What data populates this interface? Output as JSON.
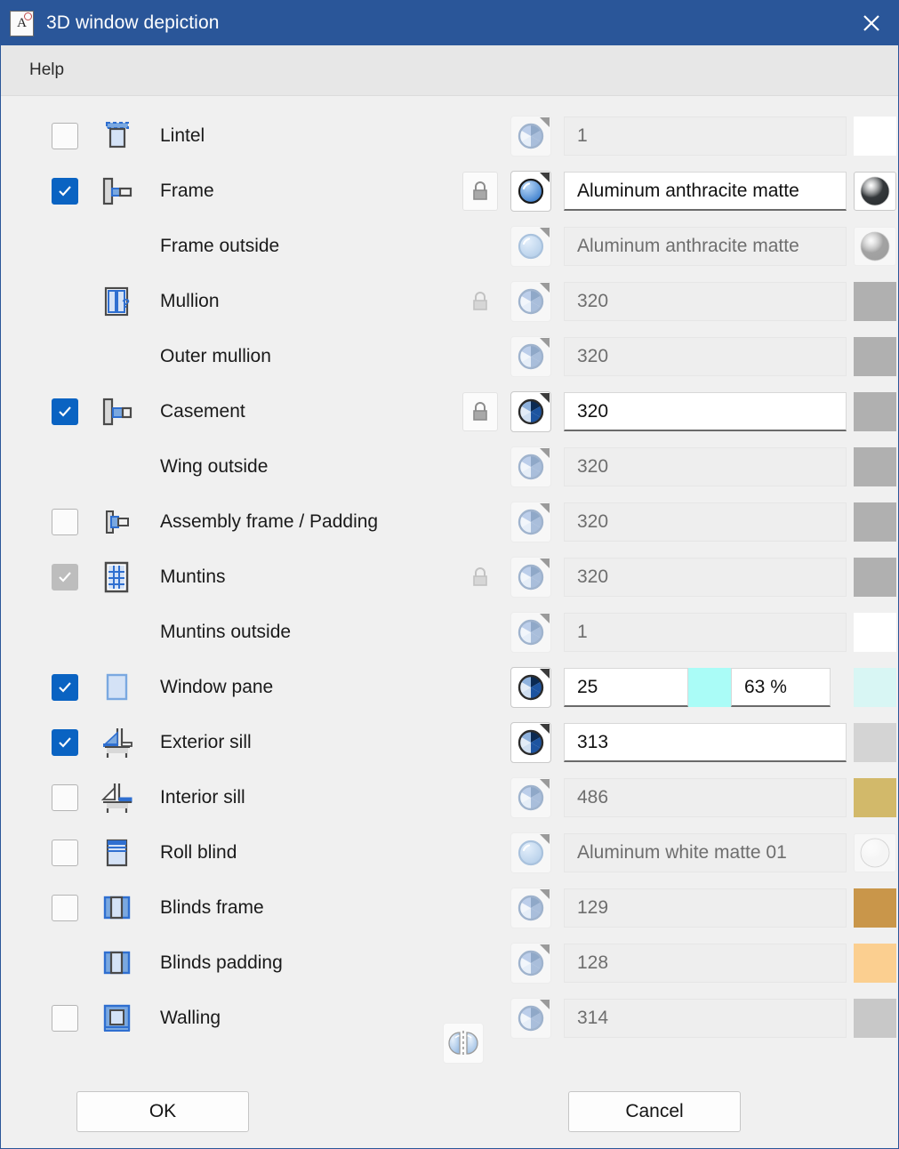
{
  "window": {
    "title": "3D window depiction",
    "app_icon": "A",
    "close_icon": "close-icon"
  },
  "menu": {
    "items": [
      {
        "label": "Help"
      }
    ]
  },
  "colors": {
    "titlebar": "#2a5699",
    "accent_checkbox": "#0a63c2",
    "disabled_checkbox": "#bdbdbd",
    "dialog_background": "#f0f0f0",
    "menubar": "#e7e7e7"
  },
  "rows": [
    {
      "label": "Lintel",
      "checkbox": "unchecked",
      "icon": "lintel-icon",
      "lock": "none",
      "picker": "color",
      "picker_active": false,
      "value": "1",
      "field_active": false,
      "swatch_type": "flat",
      "swatch_color": "#ffffff"
    },
    {
      "label": "Frame",
      "checkbox": "checked",
      "icon": "frame-icon",
      "lock": "locked",
      "picker": "material",
      "picker_active": true,
      "value": "Aluminum anthracite matte",
      "field_active": true,
      "swatch_type": "material",
      "swatch_color": "#2a2e31"
    },
    {
      "label": "Frame outside",
      "checkbox": "none",
      "icon": "none",
      "lock": "none",
      "picker": "material",
      "picker_active": false,
      "value": "Aluminum anthracite matte",
      "field_active": false,
      "swatch_type": "material",
      "swatch_color": "#9e9e9e"
    },
    {
      "label": "Mullion",
      "checkbox": "none",
      "icon": "mullion-icon",
      "lock": "locked-disabled",
      "picker": "color",
      "picker_active": false,
      "value": "320",
      "field_active": false,
      "swatch_type": "flat",
      "swatch_color": "#b0b0b0"
    },
    {
      "label": "Outer mullion",
      "checkbox": "none",
      "icon": "none",
      "lock": "none",
      "picker": "color",
      "picker_active": false,
      "value": "320",
      "field_active": false,
      "swatch_type": "flat",
      "swatch_color": "#b0b0b0"
    },
    {
      "label": "Casement",
      "checkbox": "checked",
      "icon": "casement-icon",
      "lock": "locked",
      "picker": "color",
      "picker_active": true,
      "value": "320",
      "field_active": true,
      "swatch_type": "flat",
      "swatch_color": "#b0b0b0"
    },
    {
      "label": "Wing outside",
      "checkbox": "none",
      "icon": "none",
      "lock": "none",
      "picker": "color",
      "picker_active": false,
      "value": "320",
      "field_active": false,
      "swatch_type": "flat",
      "swatch_color": "#b0b0b0"
    },
    {
      "label": "Assembly frame / Padding",
      "checkbox": "unchecked",
      "icon": "assembly-frame-icon",
      "lock": "none",
      "picker": "color",
      "picker_active": false,
      "value": "320",
      "field_active": false,
      "swatch_type": "flat",
      "swatch_color": "#b0b0b0"
    },
    {
      "label": "Muntins",
      "checkbox": "checked-disabled",
      "icon": "muntins-icon",
      "lock": "locked-disabled",
      "picker": "color",
      "picker_active": false,
      "value": "320",
      "field_active": false,
      "swatch_type": "flat",
      "swatch_color": "#b0b0b0"
    },
    {
      "label": "Muntins outside",
      "checkbox": "none",
      "icon": "none",
      "lock": "none",
      "picker": "color",
      "picker_active": false,
      "value": "1",
      "field_active": false,
      "swatch_type": "flat",
      "swatch_color": "#ffffff"
    },
    {
      "label": "Window pane",
      "checkbox": "checked",
      "icon": "window-pane-icon",
      "lock": "none",
      "picker": "color",
      "picker_active": true,
      "value": "25",
      "value2": "63 %",
      "field_active": true,
      "split": true,
      "split_swatch_color": "#aafcf7",
      "swatch_type": "flat",
      "swatch_color": "#d8f6f4"
    },
    {
      "label": "Exterior sill",
      "checkbox": "checked",
      "icon": "exterior-sill-icon",
      "lock": "none",
      "picker": "color",
      "picker_active": true,
      "value": "313",
      "field_active": true,
      "swatch_type": "flat",
      "swatch_color": "#d4d4d4"
    },
    {
      "label": "Interior sill",
      "checkbox": "unchecked",
      "icon": "interior-sill-icon",
      "lock": "none",
      "picker": "color",
      "picker_active": false,
      "value": "486",
      "field_active": false,
      "swatch_type": "flat",
      "swatch_color": "#d2b96a"
    },
    {
      "label": "Roll blind",
      "checkbox": "unchecked",
      "icon": "roll-blind-icon",
      "lock": "none",
      "picker": "material",
      "picker_active": false,
      "value": "Aluminum white matte 01",
      "field_active": false,
      "swatch_type": "material",
      "swatch_color": "#f5f5f5"
    },
    {
      "label": "Blinds frame",
      "checkbox": "unchecked",
      "icon": "blinds-frame-icon",
      "lock": "none",
      "picker": "color",
      "picker_active": false,
      "value": "129",
      "field_active": false,
      "swatch_type": "flat",
      "swatch_color": "#c9964a"
    },
    {
      "label": "Blinds padding",
      "checkbox": "none",
      "icon": "blinds-padding-icon",
      "lock": "none",
      "picker": "color",
      "picker_active": false,
      "value": "128",
      "field_active": false,
      "swatch_type": "flat",
      "swatch_color": "#fbcf90"
    },
    {
      "label": "Walling",
      "checkbox": "unchecked",
      "icon": "walling-icon",
      "lock": "none",
      "picker": "color",
      "picker_active": false,
      "value": "314",
      "field_active": false,
      "swatch_type": "flat",
      "swatch_color": "#c8c8c8"
    }
  ],
  "mirror_button": {
    "icon": "mirror-icon"
  },
  "footer": {
    "ok_label": "OK",
    "cancel_label": "Cancel"
  }
}
